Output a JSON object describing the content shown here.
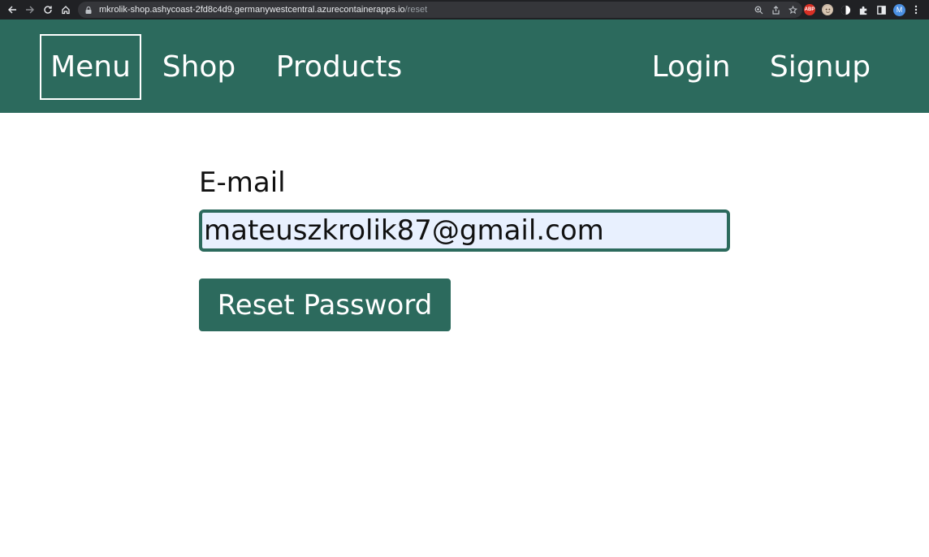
{
  "browser": {
    "url_host": "mkrolik-shop.ashycoast-2fd8c4d9.germanywestcentral.azurecontainerapps.io",
    "url_path": "/reset",
    "extension_badge": "ABP",
    "avatar_letter": "M",
    "icons": [
      "back-icon",
      "forward-icon",
      "reload-icon",
      "home-icon",
      "lock-icon",
      "zoom-icon",
      "share-icon",
      "star-icon",
      "puzzle-icon",
      "sidebar-icon",
      "kebab-icon"
    ]
  },
  "nav": {
    "menu": "Menu",
    "shop": "Shop",
    "products": "Products",
    "login": "Login",
    "signup": "Signup"
  },
  "form": {
    "email_label": "E-mail",
    "email_value": "mateuszkrolik87@gmail.com",
    "reset_button": "Reset Password"
  },
  "colors": {
    "brand": "#2c6a5d",
    "input_bg": "#e8f0fe",
    "chrome_bg": "#202124"
  }
}
